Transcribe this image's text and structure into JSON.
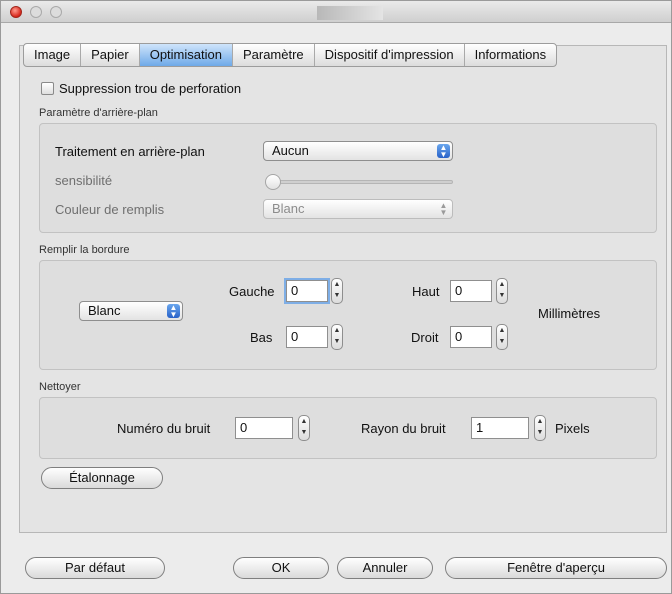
{
  "tabs": [
    "Image",
    "Papier",
    "Optimisation",
    "Paramètre",
    "Dispositif d'impression",
    "Informations"
  ],
  "active_tab": "Optimisation",
  "hole_removal": {
    "label": "Suppression trou de perforation",
    "checked": false
  },
  "background": {
    "group_label": "Paramètre d'arrière-plan",
    "processing_label": "Traitement en arrière-plan",
    "processing_value": "Aucun",
    "sensitivity_label": "sensibilité",
    "sensitivity_value": 0,
    "fill_color_label": "Couleur de remplis",
    "fill_color_value": "Blanc"
  },
  "border": {
    "group_label": "Remplir la bordure",
    "color_value": "Blanc",
    "left_label": "Gauche",
    "left_value": "0",
    "top_label": "Haut",
    "top_value": "0",
    "bottom_label": "Bas",
    "bottom_value": "0",
    "right_label": "Droit",
    "right_value": "0",
    "unit_label": "Millimètres"
  },
  "cleanup": {
    "group_label": "Nettoyer",
    "noise_number_label": "Numéro du bruit",
    "noise_number_value": "0",
    "noise_radius_label": "Rayon du bruit",
    "noise_radius_value": "1",
    "unit_label": "Pixels"
  },
  "calibration_label": "Étalonnage",
  "buttons": {
    "default": "Par défaut",
    "ok": "OK",
    "cancel": "Annuler",
    "preview": "Fenêtre d'aperçu"
  },
  "icons": {
    "close": "close-icon",
    "minimize": "minimize-icon",
    "zoom": "zoom-icon",
    "popup_arrows": "up-down-arrows-icon",
    "stepper": "stepper-arrows-icon"
  }
}
